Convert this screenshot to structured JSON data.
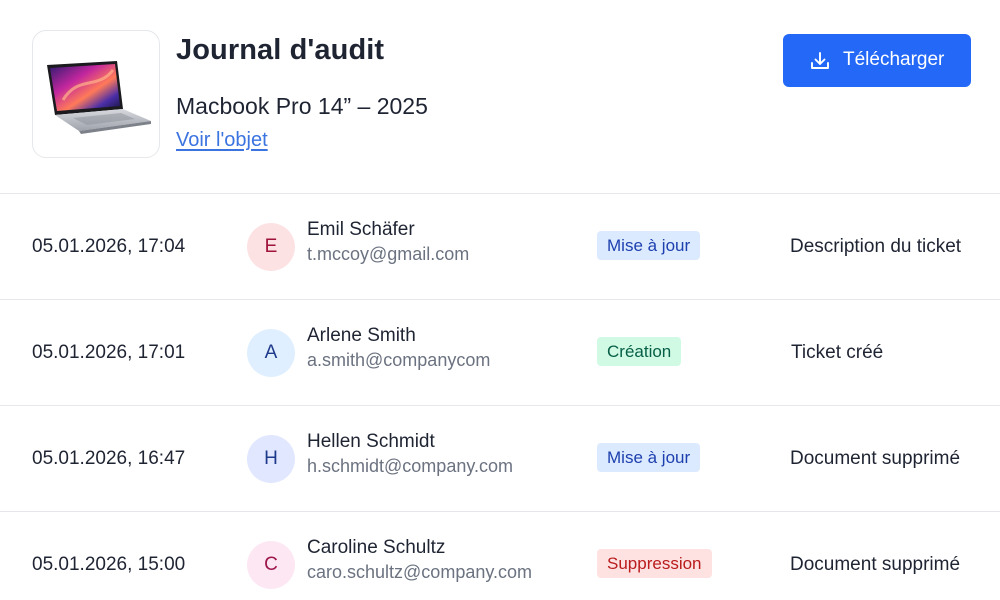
{
  "header": {
    "title": "Journal d'audit",
    "object_name": "Macbook Pro 14” – 2025",
    "view_link": "Voir l'objet",
    "download_label": "Télécharger",
    "accent_color": "#2368f7"
  },
  "rows": [
    {
      "date": "05.01.2026, 17:04",
      "initial": "E",
      "name": "Emil Schäfer",
      "email": "t.mccoy@gmail.com",
      "action": "Mise à jour",
      "action_type": "update",
      "description": "Description du ticket"
    },
    {
      "date": "05.01.2026, 17:01",
      "initial": "A",
      "name": "Arlene Smith",
      "email": "a.smith@companycom",
      "action": "Création",
      "action_type": "create",
      "description": "Ticket créé"
    },
    {
      "date": "05.01.2026, 16:47",
      "initial": "H",
      "name": "Hellen Schmidt",
      "email": "h.schmidt@company.com",
      "action": "Mise à jour",
      "action_type": "update",
      "description": "Document supprimé"
    },
    {
      "date": "05.01.2026, 15:00",
      "initial": "C",
      "name": "Caroline Schultz",
      "email": "caro.schultz@company.com",
      "action": "Suppression",
      "action_type": "delete",
      "description": "Document supprimé"
    }
  ],
  "colors": {
    "badge_update_bg": "#dbeafe",
    "badge_update_fg": "#1e40af",
    "badge_create_bg": "#d1fae5",
    "badge_create_fg": "#065f46",
    "badge_delete_bg": "#fee2e2",
    "badge_delete_fg": "#b91c1c",
    "avatar_e_bg": "#fde2e4",
    "avatar_e_fg": "#9f1239",
    "avatar_a_bg": "#e0efff",
    "avatar_a_fg": "#1e3a8a",
    "avatar_h_bg": "#e0e7ff",
    "avatar_h_fg": "#1e3a8a",
    "avatar_c_bg": "#fce7f3",
    "avatar_c_fg": "#9d174d"
  }
}
